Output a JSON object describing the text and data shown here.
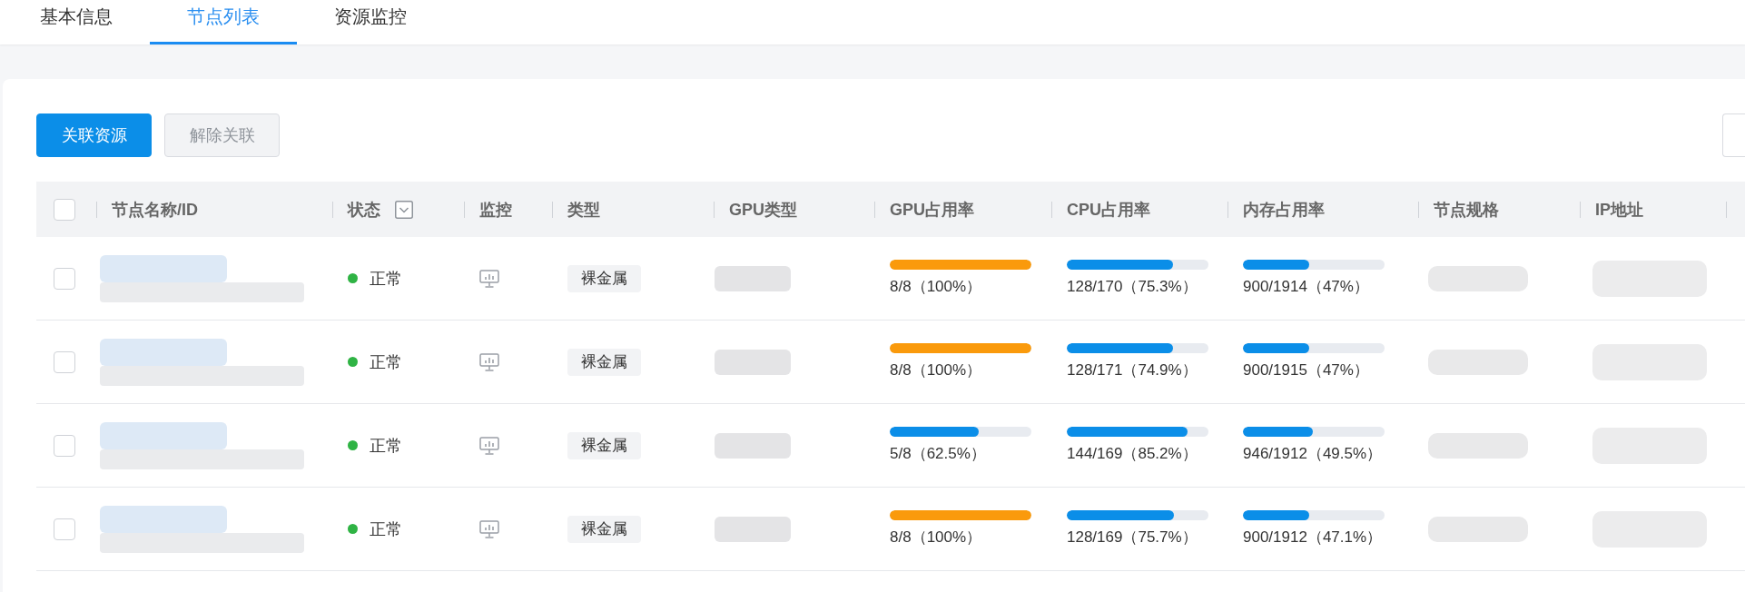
{
  "tabs": [
    {
      "label": "基本信息",
      "selected": false
    },
    {
      "label": "节点列表",
      "selected": true
    },
    {
      "label": "资源监控",
      "selected": false
    }
  ],
  "toolbar": {
    "buttons": [
      {
        "label": "关联资源",
        "kind": "primary",
        "disabled": false
      },
      {
        "label": "解除关联",
        "kind": "default",
        "disabled": true
      }
    ]
  },
  "table": {
    "header_checked": false,
    "columns": [
      {
        "label": "节点名称/ID",
        "filter": false
      },
      {
        "label": "状态",
        "filter": true
      },
      {
        "label": "监控",
        "filter": false
      },
      {
        "label": "类型",
        "filter": false
      },
      {
        "label": "GPU类型",
        "filter": false
      },
      {
        "label": "GPU占用率",
        "filter": false
      },
      {
        "label": "CPU占用率",
        "filter": false
      },
      {
        "label": "内存占用率",
        "filter": false
      },
      {
        "label": "节点规格",
        "filter": false
      },
      {
        "label": "IP地址",
        "filter": false
      }
    ],
    "rows": [
      {
        "checked": false,
        "status": {
          "label": "正常",
          "color": "#2fb344"
        },
        "type": "裸金属",
        "gpu": {
          "level": 1,
          "reading": "8/8（100%）",
          "color": "#fa9a0c"
        },
        "cpu": {
          "level": 0.753,
          "reading": "128/170（75.3%）",
          "color": "#0b8ee8"
        },
        "memory": {
          "level": 0.47,
          "reading": "900/1914（47%）",
          "color": "#0b8ee8"
        }
      },
      {
        "checked": false,
        "status": {
          "label": "正常",
          "color": "#2fb344"
        },
        "type": "裸金属",
        "gpu": {
          "level": 1,
          "reading": "8/8（100%）",
          "color": "#fa9a0c"
        },
        "cpu": {
          "level": 0.749,
          "reading": "128/171（74.9%）",
          "color": "#0b8ee8"
        },
        "memory": {
          "level": 0.47,
          "reading": "900/1915（47%）",
          "color": "#0b8ee8"
        }
      },
      {
        "checked": false,
        "status": {
          "label": "正常",
          "color": "#2fb344"
        },
        "type": "裸金属",
        "gpu": {
          "level": 0.625,
          "reading": "5/8（62.5%）",
          "color": "#0b8ee8"
        },
        "cpu": {
          "level": 0.852,
          "reading": "144/169（85.2%）",
          "color": "#0b8ee8"
        },
        "memory": {
          "level": 0.495,
          "reading": "946/1912（49.5%）",
          "color": "#0b8ee8"
        }
      },
      {
        "checked": false,
        "status": {
          "label": "正常",
          "color": "#2fb344"
        },
        "type": "裸金属",
        "gpu": {
          "level": 1,
          "reading": "8/8（100%）",
          "color": "#fa9a0c"
        },
        "cpu": {
          "level": 0.757,
          "reading": "128/169（75.7%）",
          "color": "#0b8ee8"
        },
        "memory": {
          "level": 0.471,
          "reading": "900/1912（47.1%）",
          "color": "#0b8ee8"
        }
      }
    ]
  }
}
